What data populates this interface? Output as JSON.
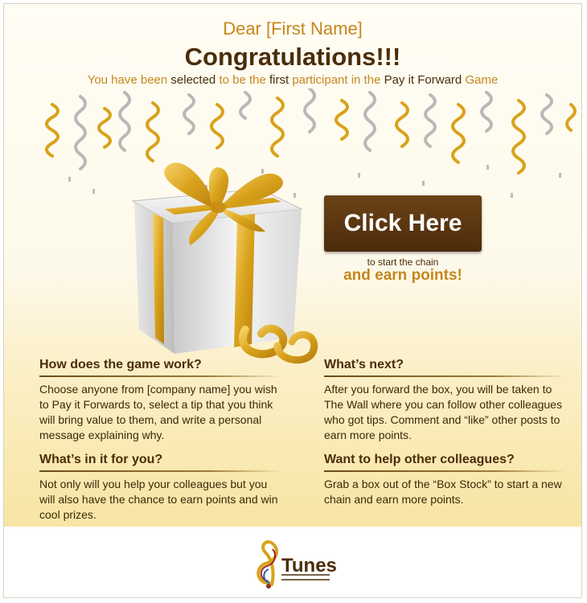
{
  "header": {
    "greeting": "Dear [First Name]",
    "title": "Congratulations!!!",
    "subtitle": {
      "p1": "You have been ",
      "p2": "selected",
      "p3": " to be the ",
      "p4": "first",
      "p5": " participant in the ",
      "p6": "Pay it Forward",
      "p7": " Game"
    }
  },
  "cta": {
    "button_label": "Click Here",
    "note": "to start the chain",
    "emphasis": "and earn points!"
  },
  "sections": {
    "how": {
      "heading": "How does the game work?",
      "body": "Choose anyone from [company name] you wish to Pay it Forwards to, select a tip that you think will bring value to them, and write a personal message explaining why."
    },
    "whats_in_it": {
      "heading": "What’s in it for you?",
      "body": "Not only will you help your colleagues but you will also have the chance to earn points and win cool prizes."
    },
    "whats_next": {
      "heading": "What’s next?",
      "body": "After you forward the box, you will be taken to The Wall where you can follow other colleagues who got tips. Comment and “like” other posts to earn more points."
    },
    "help": {
      "heading": "Want to help other colleagues?",
      "body": "Grab a box out of the “Box Stock” to start a new chain and earn more points."
    }
  },
  "footer": {
    "logo_text": "Tunes"
  },
  "colors": {
    "accent_gold": "#c4871b",
    "dark_brown": "#4b2d0a",
    "button_brown": "#5b3812"
  }
}
